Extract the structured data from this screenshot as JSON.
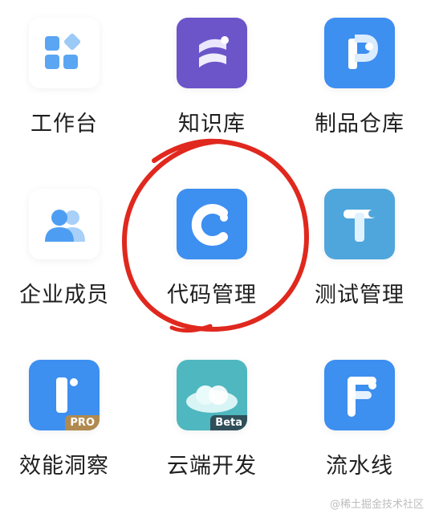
{
  "apps": [
    {
      "label": "工作台",
      "icon": "workbench-grid-icon"
    },
    {
      "label": "知识库",
      "icon": "knowledge-base-icon"
    },
    {
      "label": "制品仓库",
      "icon": "artifact-repository-icon"
    },
    {
      "label": "企业成员",
      "icon": "enterprise-members-icon"
    },
    {
      "label": "代码管理",
      "icon": "code-management-icon"
    },
    {
      "label": "测试管理",
      "icon": "test-management-icon"
    },
    {
      "label": "效能洞察",
      "icon": "efficiency-insight-icon",
      "badge": "PRO"
    },
    {
      "label": "云端开发",
      "icon": "cloud-development-icon",
      "badge": "Beta"
    },
    {
      "label": "流水线",
      "icon": "pipeline-icon"
    }
  ],
  "watermark": "@稀土掘金技术社区",
  "colors": {
    "annotation_red": "#e0281e",
    "primary_blue": "#3d8ff0",
    "purple": "#6b55c9",
    "teal": "#4fb7bf",
    "gold": "#b08a4e"
  }
}
